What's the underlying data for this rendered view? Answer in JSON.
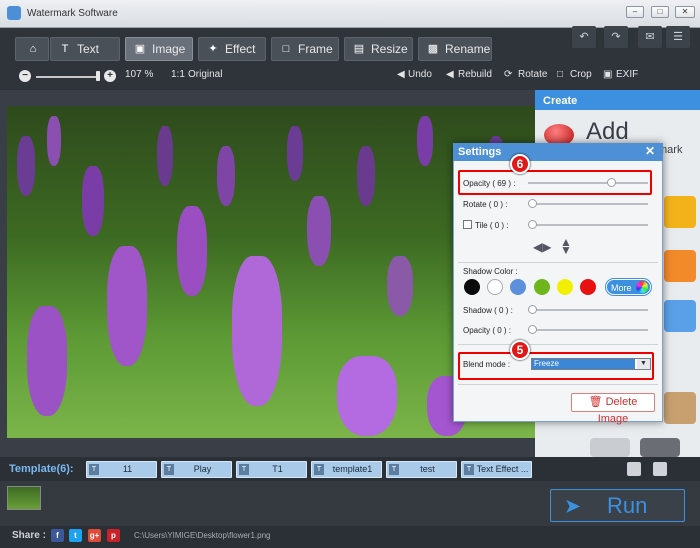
{
  "window": {
    "title": "Watermark Software"
  },
  "menu": {
    "tabs": [
      {
        "label": "Text",
        "icon": "text-icon"
      },
      {
        "label": "Image",
        "icon": "image-icon",
        "active": true
      },
      {
        "label": "Effect",
        "icon": "effect-icon"
      },
      {
        "label": "Frame",
        "icon": "frame-icon"
      },
      {
        "label": "Resize",
        "icon": "resize-icon"
      },
      {
        "label": "Rename",
        "icon": "rename-icon"
      }
    ]
  },
  "toolbar": {
    "zoom": "107 %",
    "original": "Original",
    "undo": "Undo",
    "rebuild": "Rebuild",
    "rotate": "Rotate",
    "crop": "Crop",
    "exif": "EXIF"
  },
  "create": {
    "title": "Create",
    "add": "Add",
    "mark": "mark"
  },
  "settings": {
    "title": "Settings",
    "opacity_label": "Opacity ( 69 ) :",
    "opacity_value": 0.69,
    "rotate_label": "Rotate ( 0 ) :",
    "tile_label": "Tile ( 0 ) :",
    "shadow_color_label": "Shadow Color :",
    "shadow_label": "Shadow ( 0 ) :",
    "opacity2_label": "Opacity ( 0 ) :",
    "blend_label": "Blend mode :",
    "blend_value": "Freeze",
    "more_label": "More",
    "delete_label": "Delete Image",
    "badge6": "6",
    "badge5": "5",
    "swatches": [
      "#0a0a0a",
      "#ffffff",
      "#5c8fdc",
      "#6fb51c",
      "#f0f000",
      "#e81010"
    ]
  },
  "templates": {
    "label": "Template(6):",
    "items": [
      "11",
      "Play",
      "T1",
      "template1",
      "test",
      "Text Effect ..."
    ]
  },
  "run": {
    "label": "Run"
  },
  "share": {
    "label": "Share :",
    "path": "C:\\Users\\YIMIGE\\Desktop\\flower1.png"
  }
}
